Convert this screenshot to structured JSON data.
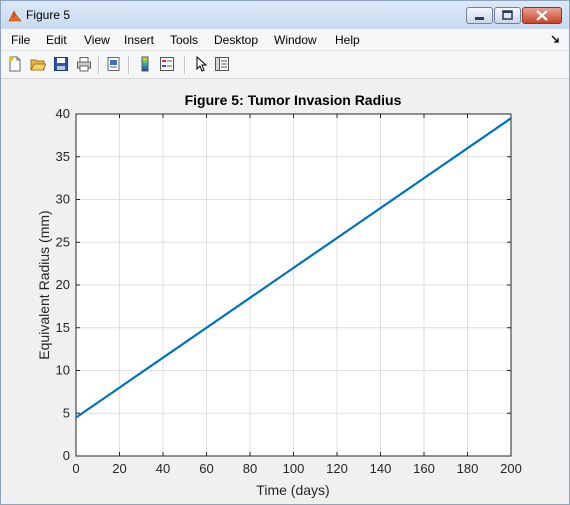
{
  "window": {
    "title": "Figure 5"
  },
  "menu": [
    "File",
    "Edit",
    "View",
    "Insert",
    "Tools",
    "Desktop",
    "Window",
    "Help"
  ],
  "toolbar_icons": [
    "new-figure-icon",
    "open-file-icon",
    "save-icon",
    "print-icon",
    "print-preview-icon",
    "colorbar-icon",
    "legend-icon",
    "pointer-icon",
    "property-editor-icon"
  ],
  "chart_data": {
    "type": "line",
    "title": "Figure 5: Tumor Invasion Radius",
    "xlabel": "Time (days)",
    "ylabel": "Equivalent Radius (mm)",
    "xlim": [
      0,
      200
    ],
    "ylim": [
      0,
      40
    ],
    "xticks": [
      0,
      20,
      40,
      60,
      80,
      100,
      120,
      140,
      160,
      180,
      200
    ],
    "yticks": [
      0,
      5,
      10,
      15,
      20,
      25,
      30,
      35,
      40
    ],
    "grid": true,
    "series": [
      {
        "color": "#0072bd",
        "x": [
          0,
          20,
          40,
          60,
          80,
          100,
          120,
          140,
          160,
          180,
          200
        ],
        "y": [
          4.5,
          8.0,
          11.5,
          15.0,
          18.5,
          22.0,
          25.5,
          29.0,
          32.5,
          36.0,
          39.5
        ]
      }
    ]
  }
}
